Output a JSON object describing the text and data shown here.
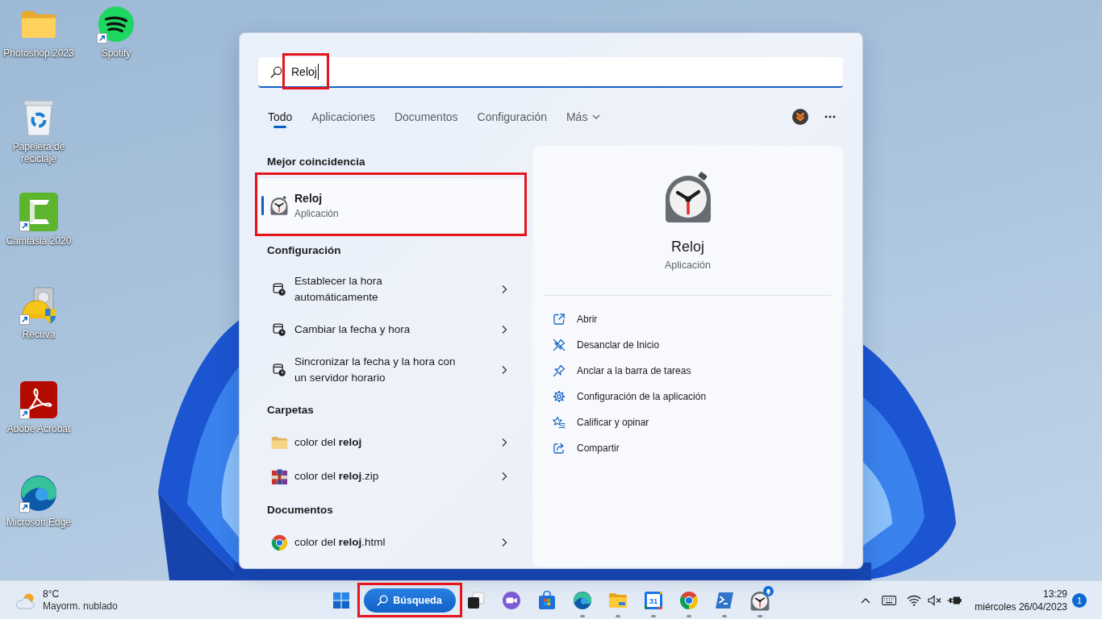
{
  "desktop": {
    "icons": [
      {
        "label": "Photoshop.2023",
        "kind": "folder",
        "shortcut": false
      },
      {
        "label": "Papelera de reciclaje",
        "kind": "recycle-bin",
        "shortcut": false
      },
      {
        "label": "Camtasia 2020",
        "kind": "camtasia",
        "shortcut": true
      },
      {
        "label": "Recuva",
        "kind": "recuva",
        "shortcut": true
      },
      {
        "label": "Adobe Acrobat",
        "kind": "acrobat",
        "shortcut": true
      },
      {
        "label": "Microsoft Edge",
        "kind": "edge",
        "shortcut": true
      },
      {
        "label": "Spotify",
        "kind": "spotify",
        "shortcut": true
      }
    ]
  },
  "search_panel": {
    "search": {
      "value": "Reloj",
      "focused": true,
      "highlighted": true
    },
    "tabs": [
      {
        "label": "Todo",
        "selected": true,
        "dropdown": false
      },
      {
        "label": "Aplicaciones",
        "selected": false,
        "dropdown": false
      },
      {
        "label": "Documentos",
        "selected": false,
        "dropdown": false
      },
      {
        "label": "Configuración",
        "selected": false,
        "dropdown": false
      },
      {
        "label": "Más",
        "selected": false,
        "dropdown": true
      }
    ],
    "sections": [
      {
        "heading": "Mejor coincidencia",
        "items": [
          {
            "kind": "app",
            "title": "Reloj",
            "subtitle": "Aplicación",
            "selected": true,
            "highlighted": true
          }
        ]
      },
      {
        "heading": "Configuración",
        "items": [
          {
            "kind": "setting",
            "title": "Establecer la hora automáticamente",
            "selected": false,
            "highlighted": false
          },
          {
            "kind": "setting",
            "title": "Cambiar la fecha y hora",
            "selected": false,
            "highlighted": false
          },
          {
            "kind": "setting",
            "title": "Sincronizar la fecha y la hora con un servidor horario",
            "selected": false,
            "highlighted": false
          }
        ]
      },
      {
        "heading": "Carpetas",
        "items": [
          {
            "kind": "folder",
            "title": "color del **reloj**",
            "selected": false,
            "highlighted": false
          },
          {
            "kind": "archive",
            "title": "color del **reloj**.zip",
            "selected": false,
            "highlighted": false
          }
        ]
      },
      {
        "heading": "Documentos",
        "items": [
          {
            "kind": "web-page",
            "title": "color del **reloj**.html",
            "selected": false,
            "highlighted": false
          }
        ]
      }
    ],
    "preview": {
      "title": "Reloj",
      "subtitle": "Aplicación",
      "actions": [
        {
          "kind": "open",
          "label": "Abrir"
        },
        {
          "kind": "unpin",
          "label": "Desanclar de Inicio"
        },
        {
          "kind": "pin",
          "label": "Anclar a la barra de tareas"
        },
        {
          "kind": "settings",
          "label": "Configuración de la aplicación"
        },
        {
          "kind": "rate",
          "label": "Calificar y opinar"
        },
        {
          "kind": "share",
          "label": "Compartir"
        }
      ]
    }
  },
  "taskbar": {
    "weather": {
      "temperature": "8°C",
      "condition": "Mayorm. nublado"
    },
    "search_button": {
      "label": "Búsqueda",
      "highlighted": true
    },
    "apps": [
      {
        "kind": "task-view",
        "running": false,
        "notification": false
      },
      {
        "kind": "chat",
        "running": false,
        "notification": false
      },
      {
        "kind": "store",
        "running": false,
        "notification": false
      },
      {
        "kind": "edge",
        "running": true,
        "notification": false
      },
      {
        "kind": "explorer",
        "running": true,
        "notification": false
      },
      {
        "kind": "calendar",
        "text": "31",
        "running": true,
        "notification": false
      },
      {
        "kind": "chrome",
        "running": true,
        "notification": false
      },
      {
        "kind": "terminal",
        "running": true,
        "notification": false
      },
      {
        "kind": "clock",
        "running": true,
        "notification": true
      }
    ],
    "clock": {
      "time": "13:29",
      "date": "miércoles 26/04/2023"
    },
    "notifications": "1"
  }
}
